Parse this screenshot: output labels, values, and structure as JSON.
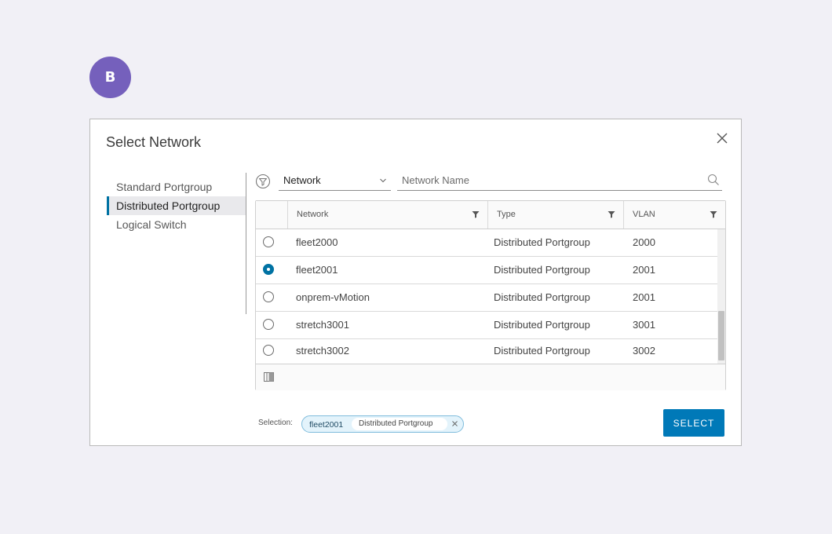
{
  "avatar": {
    "initial": "B"
  },
  "dialog": {
    "title": "Select Network",
    "close_icon": "close-icon"
  },
  "sidebar": {
    "items": [
      {
        "label": "Standard Portgroup",
        "active": false
      },
      {
        "label": "Distributed Portgroup",
        "active": true
      },
      {
        "label": "Logical Switch",
        "active": false
      }
    ]
  },
  "filter": {
    "field_select_value": "Network",
    "search_placeholder": "Network Name",
    "search_value": ""
  },
  "grid": {
    "columns": [
      {
        "label": "Network"
      },
      {
        "label": "Type"
      },
      {
        "label": "VLAN"
      }
    ],
    "rows": [
      {
        "network": "fleet2000",
        "type": "Distributed Portgroup",
        "vlan": "2000",
        "selected": false
      },
      {
        "network": "fleet2001",
        "type": "Distributed Portgroup",
        "vlan": "2001",
        "selected": true
      },
      {
        "network": "onprem-vMotion",
        "type": "Distributed Portgroup",
        "vlan": "2001",
        "selected": false
      },
      {
        "network": "stretch3001",
        "type": "Distributed Portgroup",
        "vlan": "3001",
        "selected": false
      },
      {
        "network": "stretch3002",
        "type": "Distributed Portgroup",
        "vlan": "3002",
        "selected": false
      }
    ]
  },
  "selection": {
    "label": "Selection:",
    "chip_name": "fleet2001",
    "chip_type": "Distributed Portgroup"
  },
  "actions": {
    "select_label": "SELECT"
  },
  "colors": {
    "accent": "#0079b8",
    "avatar": "#7560bc",
    "chip_border": "#7fbcdc",
    "chip_bg": "#e3f3fb"
  }
}
